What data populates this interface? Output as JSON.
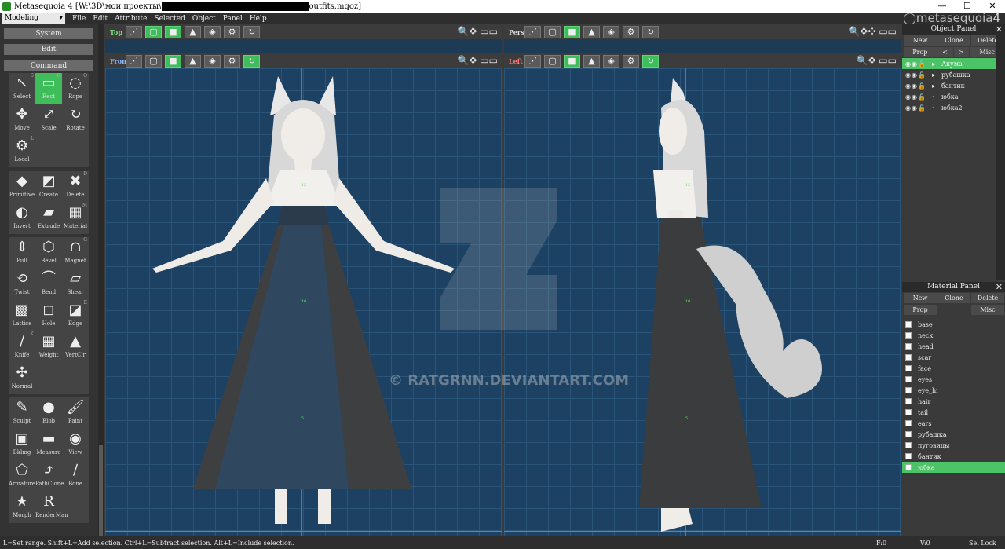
{
  "titlebar": {
    "title_prefix": "Metasequoia 4 [W:\\3D\\мои проекты\\",
    "title_suffix": "outfits.mqoz]",
    "minimize": "—",
    "maximize": "☐",
    "close": "✕"
  },
  "menubar": {
    "mode": "Modeling",
    "items": [
      "File",
      "Edit",
      "Attribute",
      "Selected",
      "Object",
      "Panel",
      "Help"
    ],
    "brand_a": "metasequoia",
    "brand_b": "4"
  },
  "left": {
    "system": "System",
    "edit": "Edit",
    "command": "Command",
    "tools1": [
      {
        "label": "Select",
        "sc": "S",
        "icon": "↖"
      },
      {
        "label": "Rect",
        "sc": "R",
        "icon": "▭",
        "on": true
      },
      {
        "label": "Rope",
        "sc": "Q",
        "icon": "◌"
      },
      {
        "label": "Move",
        "sc": "",
        "icon": "✥"
      },
      {
        "label": "Scale",
        "sc": "",
        "icon": "⤢"
      },
      {
        "label": "Rotate",
        "sc": "",
        "icon": "↻"
      },
      {
        "label": "Local",
        "sc": "L",
        "icon": "⚙"
      }
    ],
    "tools2": [
      {
        "label": "Primitive",
        "sc": "",
        "icon": "◆"
      },
      {
        "label": "Create",
        "sc": "",
        "icon": "◩"
      },
      {
        "label": "Delete",
        "sc": "D",
        "icon": "✖"
      },
      {
        "label": "Invert",
        "sc": "",
        "icon": "◐"
      },
      {
        "label": "Extrude",
        "sc": "",
        "icon": "▰"
      },
      {
        "label": "Material",
        "sc": "M",
        "icon": "▦"
      }
    ],
    "tools3": [
      {
        "label": "Pull",
        "sc": "",
        "icon": "⇕"
      },
      {
        "label": "Bevel",
        "sc": "",
        "icon": "⬡"
      },
      {
        "label": "Magnet",
        "sc": "G",
        "icon": "∩"
      },
      {
        "label": "Twist",
        "sc": "",
        "icon": "⟲"
      },
      {
        "label": "Bend",
        "sc": "",
        "icon": "⌒"
      },
      {
        "label": "Shear",
        "sc": "",
        "icon": "▱"
      },
      {
        "label": "Lattice",
        "sc": "",
        "icon": "▩"
      },
      {
        "label": "Hole",
        "sc": "",
        "icon": "◻"
      },
      {
        "label": "Edge",
        "sc": "E",
        "icon": "◪"
      },
      {
        "label": "Knife",
        "sc": "K",
        "icon": "/"
      },
      {
        "label": "Weight",
        "sc": "",
        "icon": "▦"
      },
      {
        "label": "VertClr",
        "sc": "",
        "icon": "▲"
      },
      {
        "label": "Normal",
        "sc": "",
        "icon": "✣"
      }
    ],
    "tools4": [
      {
        "label": "Sculpt",
        "sc": "",
        "icon": "✎"
      },
      {
        "label": "Blob",
        "sc": "",
        "icon": "●"
      },
      {
        "label": "Paint",
        "sc": "",
        "icon": "🖌"
      },
      {
        "label": "Bklmg",
        "sc": "",
        "icon": "▣"
      },
      {
        "label": "Measure",
        "sc": "",
        "icon": "▬"
      },
      {
        "label": "View",
        "sc": "",
        "icon": "◉"
      },
      {
        "label": "Armature",
        "sc": "",
        "icon": "⬠"
      },
      {
        "label": "PathClone",
        "sc": "",
        "icon": "⤴"
      },
      {
        "label": "Bone",
        "sc": "",
        "icon": "∕"
      },
      {
        "label": "Morph",
        "sc": "",
        "icon": "★"
      },
      {
        "label": "RenderMan",
        "sc": "",
        "icon": "R"
      }
    ]
  },
  "views": {
    "top": "Top",
    "pers": "Pers",
    "front": "Front",
    "left": "Left",
    "mark_top": "15",
    "mark_mid": "10",
    "mark_low": "5"
  },
  "watermark": "© RATGRNN.DEVIANTART.COM",
  "object_panel": {
    "title": "Object Panel",
    "new": "New",
    "clone": "Clone",
    "delete": "Delete",
    "prop": "Prop",
    "prev": "<",
    "next": ">",
    "misc": "Misc",
    "objects": [
      {
        "name": "Акума",
        "sel": true,
        "arrow": "▸"
      },
      {
        "name": "рубашка",
        "sel": false,
        "arrow": "▸"
      },
      {
        "name": "бантик",
        "sel": false,
        "arrow": "▸"
      },
      {
        "name": "юбка",
        "sel": false,
        "arrow": "·"
      },
      {
        "name": "юбка2",
        "sel": false,
        "arrow": "·"
      }
    ]
  },
  "material_panel": {
    "title": "Material Panel",
    "new": "New",
    "clone": "Clone",
    "delete": "Delete",
    "prop": "Prop",
    "misc": "Misc",
    "materials": [
      "base",
      "neck",
      "head",
      "scar",
      "face",
      "eyes",
      "eye_hi",
      "hair",
      "tail",
      "ears",
      "рубашка",
      "пуговицы",
      "бантик",
      "юбка"
    ],
    "selected": 13
  },
  "status": {
    "hint": "L=Set range.  Shift+L=Add selection.  Ctrl+L=Subtract selection.  Alt+L=Include selection.",
    "f": "F:0",
    "v": "V:0",
    "sellock": "Sel Lock"
  },
  "colors": {
    "accent": "#3fbd5a",
    "viewport": "#1d4163"
  }
}
